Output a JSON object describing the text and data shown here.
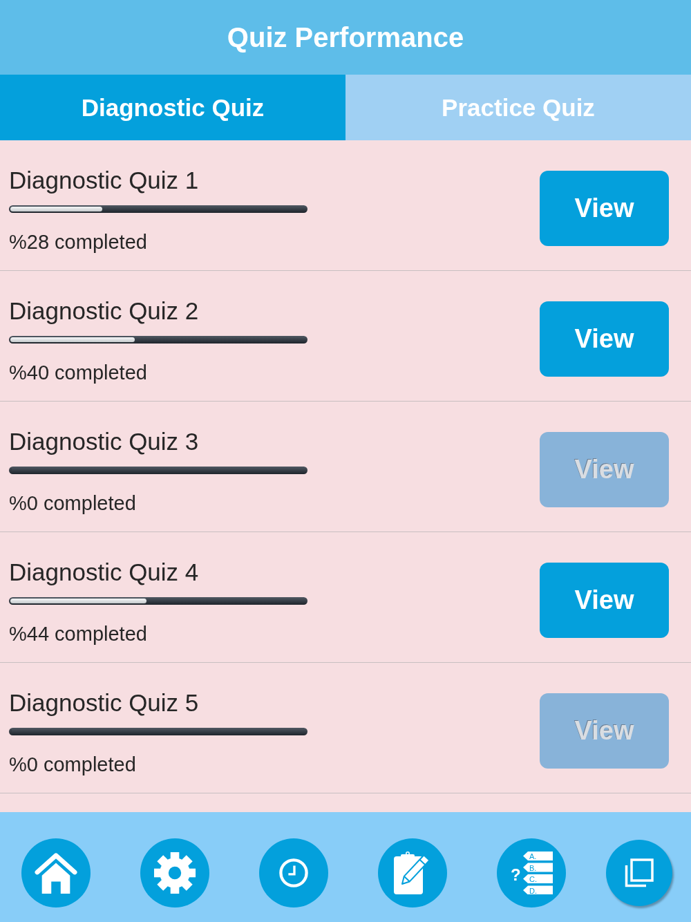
{
  "header": {
    "title": "Quiz Performance"
  },
  "tabs": [
    {
      "label": "Diagnostic Quiz",
      "selected": true
    },
    {
      "label": "Practice Quiz",
      "selected": false
    }
  ],
  "quizzes": [
    {
      "title": "Diagnostic Quiz 1",
      "level": 0.31,
      "progress_text": "%28 completed",
      "button": {
        "label": "View",
        "disabled": false
      }
    },
    {
      "title": "Diagnostic Quiz 2",
      "level": 0.42,
      "progress_text": "%40 completed",
      "button": {
        "label": "View",
        "disabled": false
      }
    },
    {
      "title": "Diagnostic Quiz 3",
      "level": 0,
      "progress_text": "%0 completed",
      "button": {
        "label": "View",
        "disabled": true
      }
    },
    {
      "title": "Diagnostic Quiz 4",
      "level": 0.46,
      "progress_text": "%44 completed",
      "button": {
        "label": "View",
        "disabled": false
      }
    },
    {
      "title": "Diagnostic Quiz 5",
      "level": 0,
      "progress_text": "%0 completed",
      "button": {
        "label": "View",
        "disabled": true
      }
    }
  ],
  "nav": [
    {
      "kind": "home"
    },
    {
      "kind": "settings"
    },
    {
      "kind": "clock"
    },
    {
      "kind": "notes"
    },
    {
      "kind": "quiz",
      "symbol": "?",
      "options": [
        "A.",
        "B.",
        "C.",
        "D."
      ]
    },
    {
      "kind": "pages"
    }
  ]
}
